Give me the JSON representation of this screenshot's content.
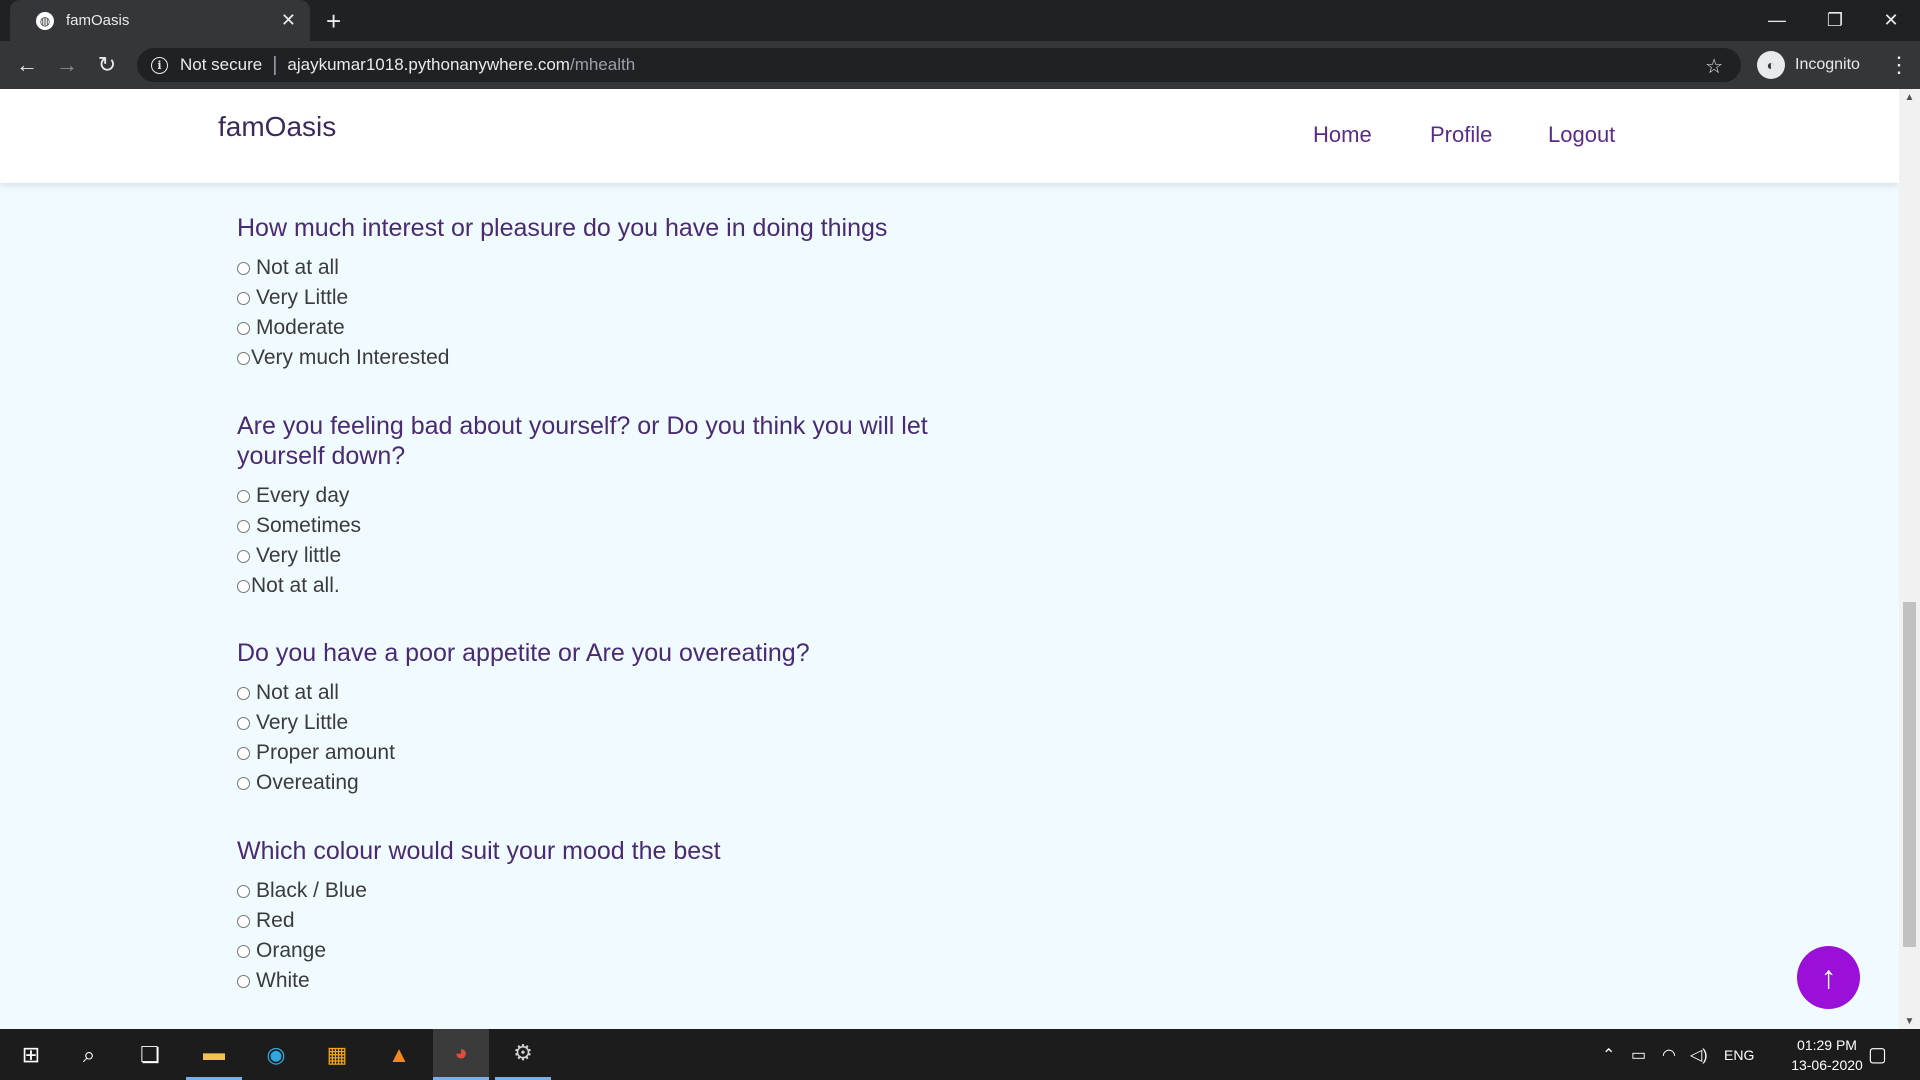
{
  "browser": {
    "tab_title": "famOasis",
    "tab_favicon": "globe-icon",
    "security_label": "Not secure",
    "url_host": "ajaykumar1018.pythonanywhere.com",
    "url_path": "/mhealth",
    "profile_label": "Incognito"
  },
  "site": {
    "brand": "famOasis",
    "nav": [
      "Home",
      "Profile",
      "Logout"
    ]
  },
  "questions": [
    {
      "text": "How much interest or pleasure do you have in doing things",
      "options": [
        "Not at all",
        "Very Little",
        "Moderate",
        "Very much Interested"
      ]
    },
    {
      "text": "Are you feeling bad about yourself? or Do you think you will let yourself down?",
      "options": [
        "Every day",
        "Sometimes",
        "Very little",
        "Not at all."
      ]
    },
    {
      "text": "Do you have a poor appetite or Are you overeating?",
      "options": [
        "Not at all",
        "Very Little",
        "Proper amount",
        "Overeating"
      ]
    },
    {
      "text": "Which colour would suit your mood the best",
      "options": [
        "Black / Blue",
        "Red",
        "Orange",
        "White"
      ]
    }
  ],
  "scroll_top_icon": "arrow-up-icon",
  "colors": {
    "accent": "#9b10d8",
    "heading": "#4a2a70",
    "nav": "#5b2b8a",
    "page_bg": "#f0fbff"
  },
  "taskbar": {
    "language": "ENG",
    "time": "01:29 PM",
    "date": "13-06-2020"
  }
}
